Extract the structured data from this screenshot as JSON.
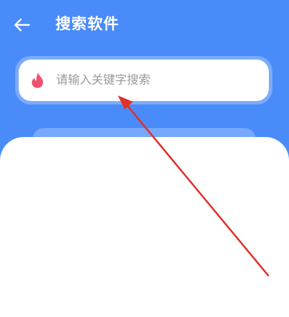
{
  "header": {
    "title": "搜索软件",
    "back_icon": "arrow-left-icon"
  },
  "search": {
    "placeholder": "请输入关键字搜索",
    "icon": "flame-icon",
    "icon_color": "#f0516e"
  },
  "colors": {
    "header_background": "#4a8bfa",
    "panel_background": "#ffffff",
    "annotation_arrow": "#e0312b"
  }
}
